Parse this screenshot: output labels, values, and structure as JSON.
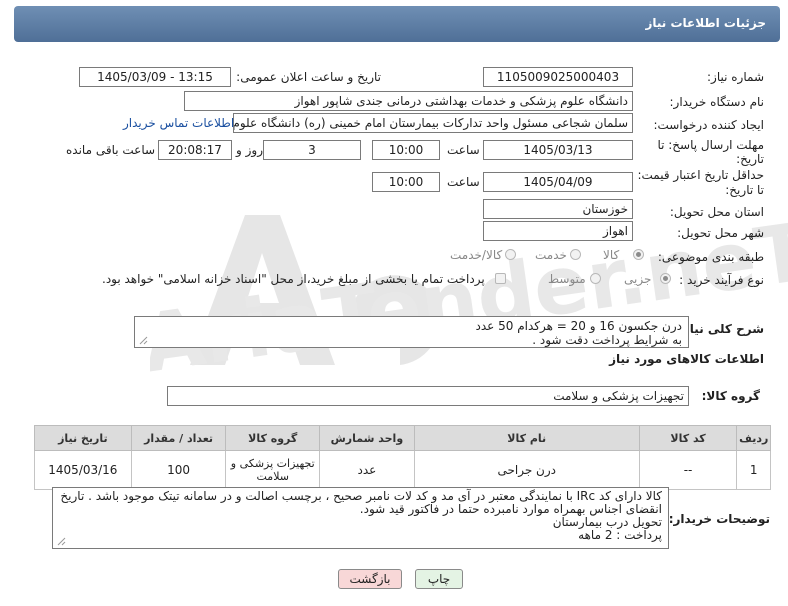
{
  "header": {
    "title": "جزئیات اطلاعات نیاز"
  },
  "fields": {
    "need_number_label": "شماره نیاز:",
    "need_number": "1105009025000403",
    "announce_label": "تاریخ و ساعت اعلان عمومی:",
    "announce_value": "1405/03/09 - 13:15",
    "buyer_org_label": "نام دستگاه خریدار:",
    "buyer_org": "دانشگاه علوم پزشکی و خدمات بهداشتی درمانی جندی شاپور اهواز",
    "requester_label": "ایجاد کننده درخواست:",
    "requester": "سلمان شجاعی مسئول واحد تدارکات بیمارستان امام خمینی (ره) دانشگاه علوم",
    "contact_link": "اطلاعات تماس خریدار",
    "deadline_label_1": "مهلت ارسال پاسخ: تا",
    "deadline_label_2": "تاریخ:",
    "deadline_date": "1405/03/13",
    "time_label": "ساعت",
    "deadline_time": "10:00",
    "days_value": "3",
    "days_label": "روز و",
    "remaining_time": "20:08:17",
    "remaining_label": "ساعت باقی مانده",
    "price_label_1": "حداقل تاریخ اعتبار قیمت:",
    "price_label_2": "تا تاریخ:",
    "price_date": "1405/04/09",
    "price_time": "10:00",
    "province_label": "استان محل تحویل:",
    "province": "خوزستان",
    "city_label": "شهر محل تحویل:",
    "city": "اهواز",
    "category_label": "طبقه بندی موضوعی:",
    "category_options": [
      "کالا",
      "خدمت",
      "کالا/خدمت"
    ],
    "process_label": "نوع فرآیند خرید :",
    "process_options": [
      "جزیی",
      "متوسط"
    ],
    "payment_note": "پرداخت تمام یا بخشی از مبلغ خرید،از محل \"اسناد خزانه اسلامی\" خواهد بود.",
    "summary_label": "شرح کلی نیاز:",
    "summary_lines": [
      "درن جکسون 16 و 20 = هرکدام 50 عدد",
      "به شرایط پرداخت دقت شود ."
    ]
  },
  "goods": {
    "section_title": "اطلاعات کالاهای مورد نیاز",
    "group_label": "گروه کالا:",
    "group_value": "تجهیزات پزشکی و سلامت",
    "columns": [
      "ردیف",
      "کد کالا",
      "نام کالا",
      "واحد شمارش",
      "گروه کالا",
      "تعداد / مقدار",
      "تاریخ نیاز"
    ],
    "rows": [
      {
        "row": "1",
        "code": "--",
        "name": "درن جراحی",
        "unit": "عدد",
        "group": "تجهیزات پزشکی و سلامت",
        "qty": "100",
        "date": "1405/03/16"
      }
    ]
  },
  "buyer_notes": {
    "label": "توضیحات خریدار:",
    "lines": [
      "کالا دارای کد IRc با نمایندگی معتبر در آی مد و کد لات نامبر صحیح ، برچسب اصالت و در سامانه تیتک موجود باشد . تاریخ",
      "انقضای اجناس بهمراه موارد نامبرده حتما در فاکتور قید شود.",
      "تحویل درب بیمارستان",
      "پرداخت : 2 ماهه"
    ]
  },
  "buttons": {
    "print": "چاپ",
    "back": "بازگشت"
  },
  "colors": {
    "header": "#5d7ea6",
    "link": "#1a4fa0",
    "back_bg": "#f8d7d7",
    "print_bg": "#e4f3e4"
  }
}
